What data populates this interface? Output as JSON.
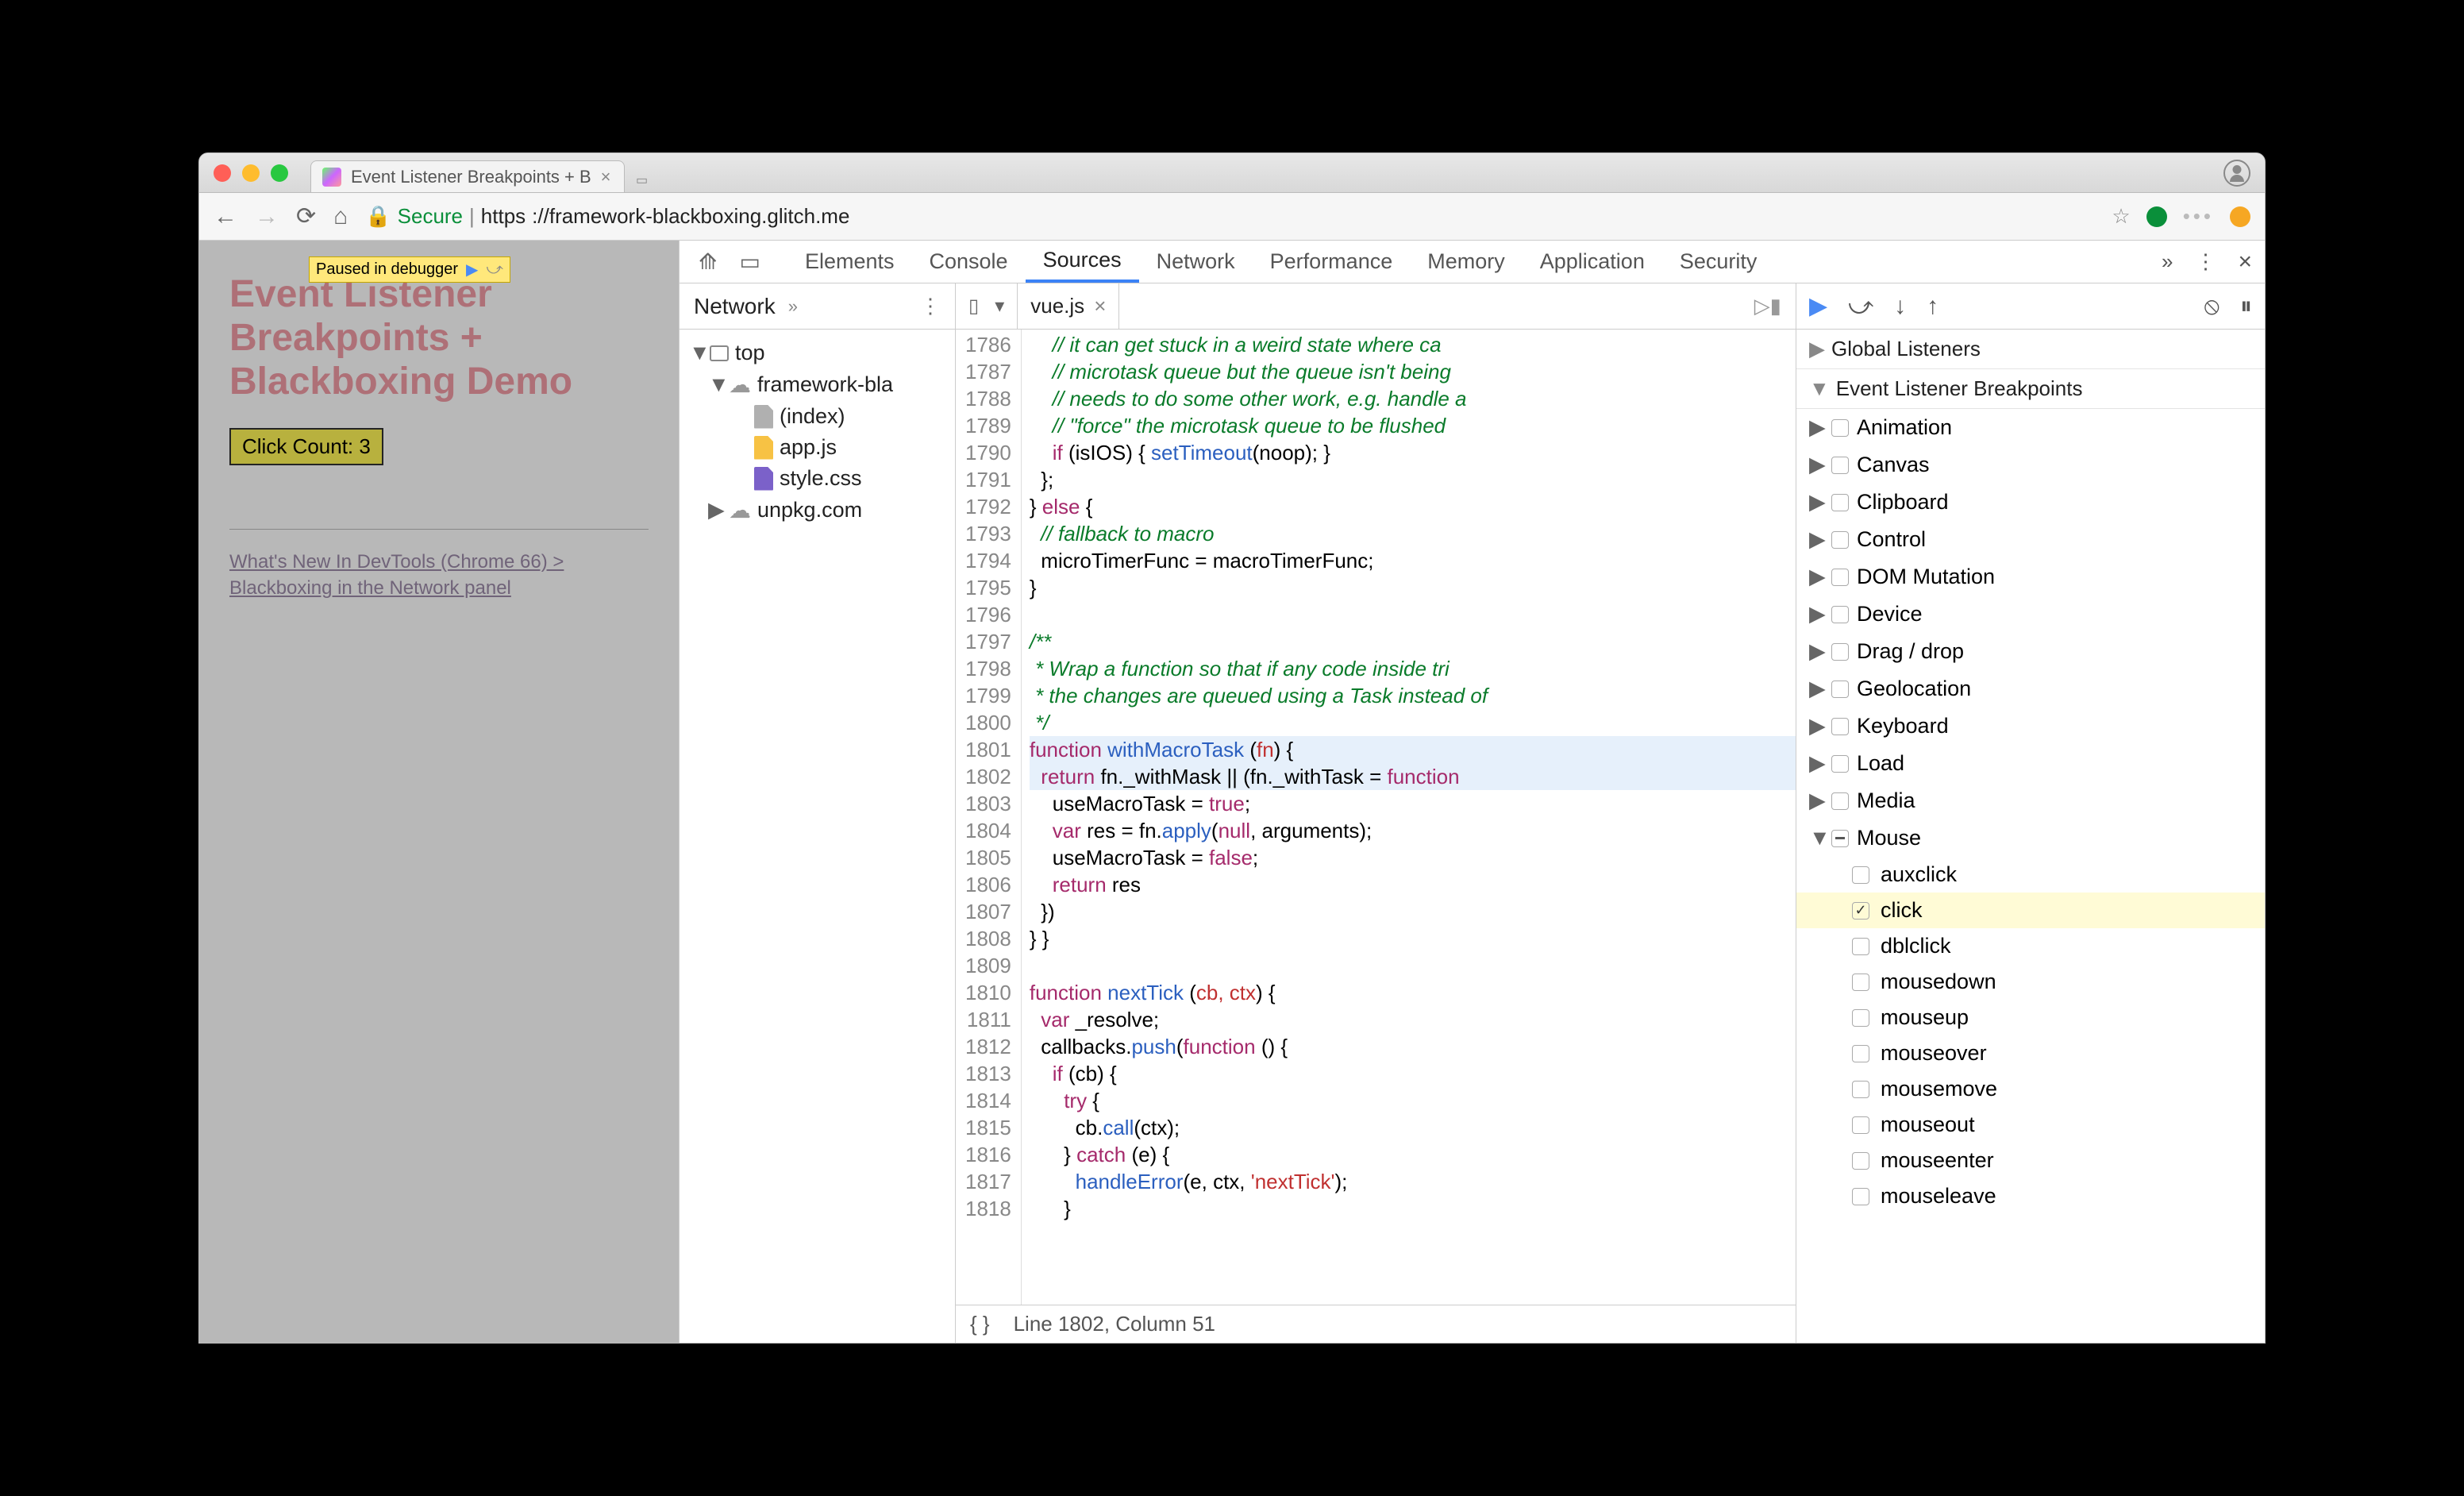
{
  "browser": {
    "tab_title": "Event Listener Breakpoints + B",
    "url_secure": "Secure",
    "url_host": "https",
    "url_rest": "://framework-blackboxing.glitch.me"
  },
  "page": {
    "paused": "Paused in debugger",
    "title": "Event Listener Breakpoints + Blackboxing Demo",
    "button": "Click Count: 3",
    "link": "What's New In DevTools (Chrome 66) > Blackboxing in the Network panel"
  },
  "devtools": {
    "tabs": [
      "Elements",
      "Console",
      "Sources",
      "Network",
      "Performance",
      "Memory",
      "Application",
      "Security"
    ],
    "active_tab": "Sources"
  },
  "navigator": {
    "tab": "Network",
    "tree": {
      "top": "top",
      "domain": "framework-bla",
      "files": [
        "(index)",
        "app.js",
        "style.css"
      ],
      "cdn": "unpkg.com"
    }
  },
  "editor": {
    "filename": "vue.js",
    "status_line": "Line 1802, Column 51",
    "first_line": 1786,
    "tokens": [
      [
        [
          "com",
          "    // it can get stuck in a weird state where ca"
        ]
      ],
      [
        [
          "com",
          "    // microtask queue but the queue isn't being "
        ]
      ],
      [
        [
          "com",
          "    // needs to do some other work, e.g. handle a"
        ]
      ],
      [
        [
          "com",
          "    // \"force\" the microtask queue to be flushed "
        ]
      ],
      [
        [
          "t",
          "    "
        ],
        [
          "kw",
          "if"
        ],
        [
          "t",
          " (isIOS) { "
        ],
        [
          "fn",
          "setTimeout"
        ],
        [
          "t",
          "(noop); }"
        ]
      ],
      [
        [
          "t",
          "  };"
        ]
      ],
      [
        [
          "t",
          "} "
        ],
        [
          "kw",
          "else"
        ],
        [
          "t",
          " {"
        ]
      ],
      [
        [
          "t",
          "  "
        ],
        [
          "com",
          "// fallback to macro"
        ]
      ],
      [
        [
          "t",
          "  microTimerFunc = macroTimerFunc;"
        ]
      ],
      [
        [
          "t",
          "}"
        ]
      ],
      [
        [
          "t",
          " "
        ]
      ],
      [
        [
          "com",
          "/**"
        ]
      ],
      [
        [
          "com",
          " * Wrap a function so that if any code inside tri"
        ]
      ],
      [
        [
          "com",
          " * the changes are queued using a Task instead of"
        ]
      ],
      [
        [
          "com",
          " */"
        ]
      ],
      [
        [
          "kw",
          "function"
        ],
        [
          "t",
          " "
        ],
        [
          "fn",
          "withMacroTask"
        ],
        [
          "t",
          " ("
        ],
        [
          "def",
          "fn"
        ],
        [
          "t",
          ") {"
        ]
      ],
      [
        [
          "t",
          "  "
        ],
        [
          "kw",
          "return"
        ],
        [
          "t",
          " fn._withMask || (fn._withTask = "
        ],
        [
          "kw",
          "function"
        ]
      ],
      [
        [
          "t",
          "    useMacroTask = "
        ],
        [
          "kw",
          "true"
        ],
        [
          "t",
          ";"
        ]
      ],
      [
        [
          "t",
          "    "
        ],
        [
          "kw",
          "var"
        ],
        [
          "t",
          " res = fn."
        ],
        [
          "fn",
          "apply"
        ],
        [
          "t",
          "("
        ],
        [
          "kw",
          "null"
        ],
        [
          "t",
          ", arguments);"
        ]
      ],
      [
        [
          "t",
          "    useMacroTask = "
        ],
        [
          "kw",
          "false"
        ],
        [
          "t",
          ";"
        ]
      ],
      [
        [
          "t",
          "    "
        ],
        [
          "kw",
          "return"
        ],
        [
          "t",
          " res"
        ]
      ],
      [
        [
          "t",
          "  })"
        ]
      ],
      [
        [
          "t",
          "} }"
        ]
      ],
      [
        [
          "t",
          " "
        ]
      ],
      [
        [
          "kw",
          "function"
        ],
        [
          "t",
          " "
        ],
        [
          "fn",
          "nextTick"
        ],
        [
          "t",
          " ("
        ],
        [
          "def",
          "cb, ctx"
        ],
        [
          "t",
          ") {"
        ]
      ],
      [
        [
          "t",
          "  "
        ],
        [
          "kw",
          "var"
        ],
        [
          "t",
          " _resolve;"
        ]
      ],
      [
        [
          "t",
          "  callbacks."
        ],
        [
          "fn",
          "push"
        ],
        [
          "t",
          "("
        ],
        [
          "kw",
          "function"
        ],
        [
          "t",
          " () {"
        ]
      ],
      [
        [
          "t",
          "    "
        ],
        [
          "kw",
          "if"
        ],
        [
          "t",
          " (cb) {"
        ]
      ],
      [
        [
          "t",
          "      "
        ],
        [
          "kw",
          "try"
        ],
        [
          "t",
          " {"
        ]
      ],
      [
        [
          "t",
          "        cb."
        ],
        [
          "fn",
          "call"
        ],
        [
          "t",
          "(ctx);"
        ]
      ],
      [
        [
          "t",
          "      } "
        ],
        [
          "kw",
          "catch"
        ],
        [
          "t",
          " (e) {"
        ]
      ],
      [
        [
          "t",
          "        "
        ],
        [
          "fn",
          "handleError"
        ],
        [
          "t",
          "(e, ctx, "
        ],
        [
          "str",
          "'nextTick'"
        ],
        [
          "t",
          ");"
        ]
      ],
      [
        [
          "t",
          "      }"
        ]
      ]
    ],
    "highlight_rows": [
      15,
      16
    ]
  },
  "debugger": {
    "sections": [
      "Global Listeners",
      "Event Listener Breakpoints"
    ],
    "categories": [
      "Animation",
      "Canvas",
      "Clipboard",
      "Control",
      "DOM Mutation",
      "Device",
      "Drag / drop",
      "Geolocation",
      "Keyboard",
      "Load",
      "Media",
      "Mouse"
    ],
    "mouse_events": [
      "auxclick",
      "click",
      "dblclick",
      "mousedown",
      "mouseup",
      "mouseover",
      "mousemove",
      "mouseout",
      "mouseenter",
      "mouseleave"
    ],
    "checked": "click"
  }
}
